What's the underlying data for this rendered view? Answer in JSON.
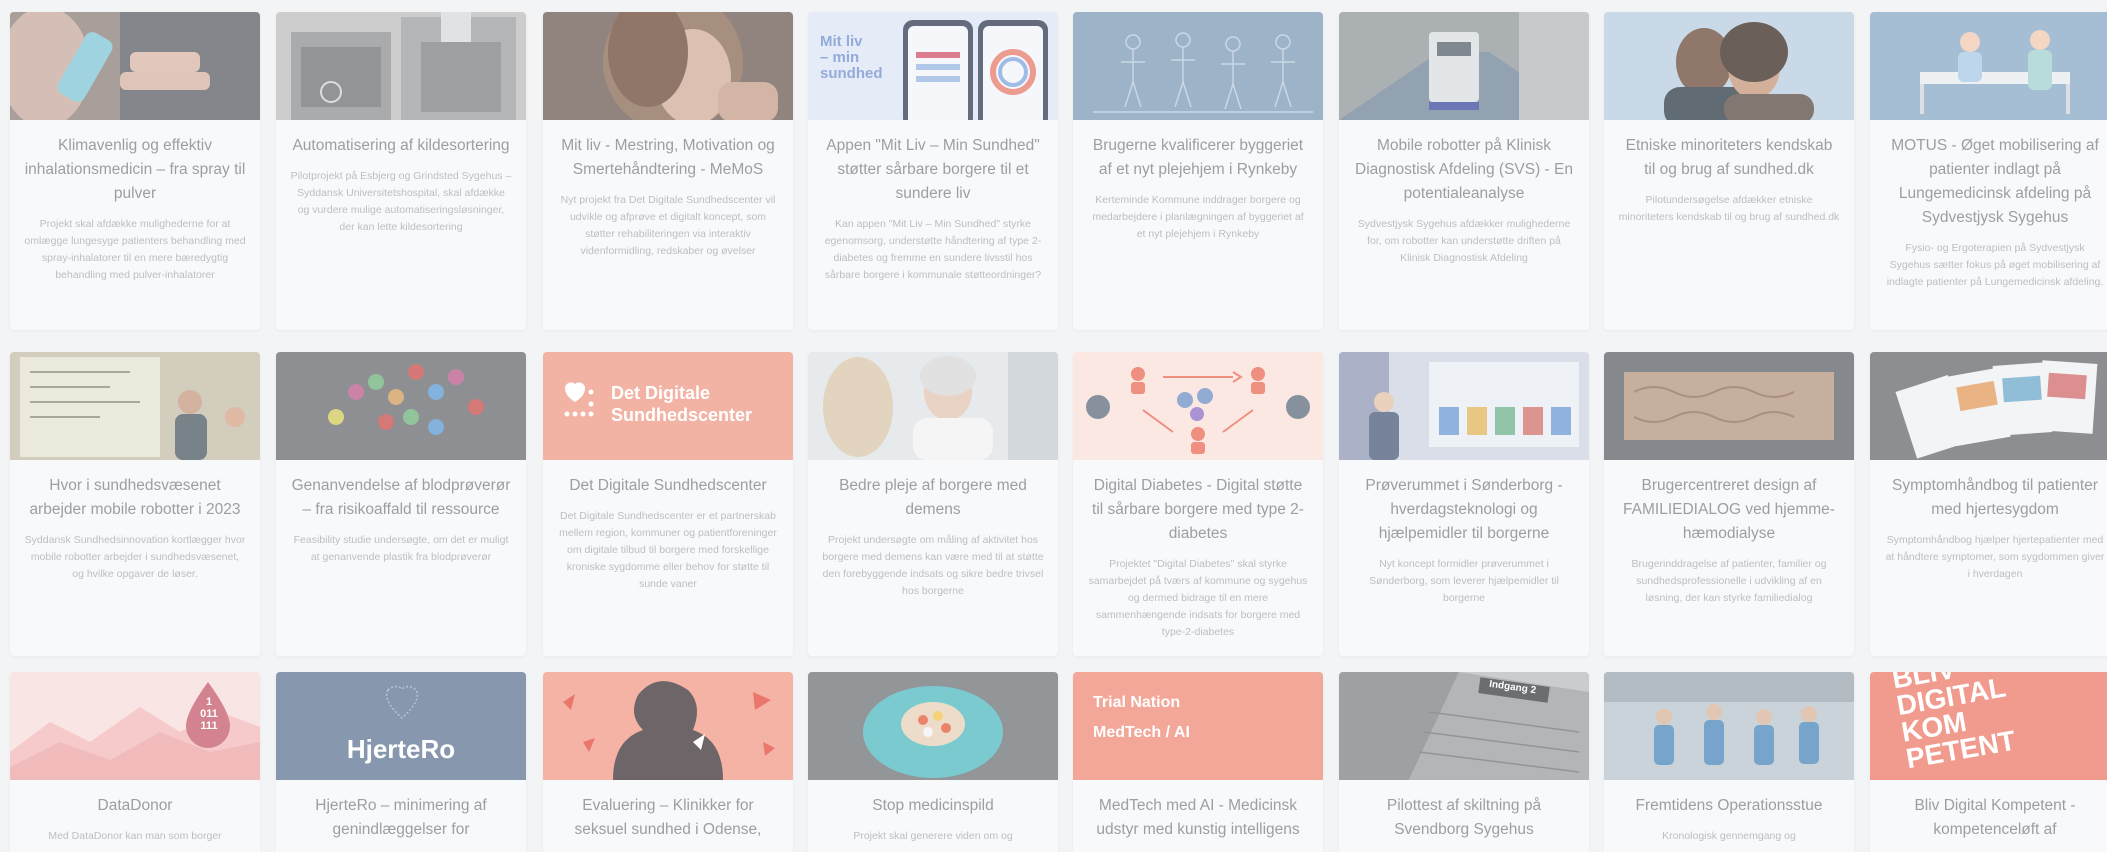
{
  "cards": [
    {
      "title": "Klimavenlig og effektiv inhalationsmedicin – fra spray til pulver",
      "desc": "Projekt skal afdække mulighederne for at omlægge lungesyge patienters behandling med spray-inhalatorer til en mere bæredygtig behandling med pulver-inhalatorer",
      "image": "inhaler-photo"
    },
    {
      "title": "Automatisering af kildesortering",
      "desc": "Pilotprojekt på Esbjerg og Grindsted Sygehus – Syddansk Universitetshospital, skal afdække og vurdere mulige automatiseringsløsninger, der kan lette kildesortering",
      "image": "waste-bins-photo"
    },
    {
      "title": "Mit liv - Mestring, Motivation og Smertehåndtering - MeMoS",
      "desc": "Nyt projekt fra Det Digitale Sundhedscenter vil udvikle og afprøve et digitalt koncept, som støtter rehabiliteringen via interaktiv videnformidling, redskaber og øvelser",
      "image": "woman-pain-photo"
    },
    {
      "title": "Appen \"Mit Liv – Min Sundhed\" støtter sårbare borgere til et sundere liv",
      "desc": "Kan appen \"Mit Liv – Min Sundhed\" styrke egenomsorg, understøtte håndtering af type 2-diabetes og fremme en sundere livsstil hos sårbare borgere i kommunale støtteordninger?",
      "image": "app-screens",
      "overlay": "Mit liv\n– min\nsundhed"
    },
    {
      "title": "Brugerne kvalificerer byggeriet af et nyt plejehjem i Rynkeby",
      "desc": "Kerteminde Kommune inddrager borgere og medarbejdere i planlægningen af byggeriet af et nyt plejehjem i Rynkeby",
      "image": "sketch-people"
    },
    {
      "title": "Mobile robotter på Klinisk Diagnostisk Afdeling (SVS) - En potentialeanalyse",
      "desc": "Sydvestjysk Sygehus afdækker mulighederne for, om robotter kan understøtte driften på Klinisk Diagnostisk Afdeling",
      "image": "robot-corridor-photo"
    },
    {
      "title": "Etniske minoriteters kendskab til og brug af sundhed.dk",
      "desc": "Pilotundersøgelse afdækker etniske minoriteters kendskab til og brug af sundhed.dk",
      "image": "couple-photo"
    },
    {
      "title": "MOTUS - Øget mobilisering af patienter indlagt på Lungemedicinsk afdeling på Sydvestjysk Sygehus",
      "desc": "Fysio- og Ergoterapien på Sydvestjysk Sygehus sætter fokus på øget mobilisering af indlagte patienter på Lungemedicinsk afdeling.",
      "image": "hospital-bed-illustration"
    },
    {
      "title": "Hvor i sundhedsvæsenet arbejder mobile robotter i 2023",
      "desc": "Syddansk Sundhedsinnovation kortlægger hvor mobile robotter arbejder i sundhedsvæsenet, og hvilke opgaver de løser.",
      "image": "whiteboard-photo"
    },
    {
      "title": "Genanvendelse af blodprøverør – fra risikoaffald til ressource",
      "desc": "Feasibility studie undersøgte, om det er muligt at genanvende plastik fra blodprøverør",
      "image": "blood-tubes-photo"
    },
    {
      "title": "Det Digitale Sundhedscenter",
      "desc": "Det Digitale Sundhedscenter er et partnerskab mellem region, kommuner og patientforeninger om digitale tilbud til borgere med forskellige kroniske sygdomme eller behov for støtte til sunde vaner",
      "image": "logo-banner",
      "overlay": "Det Digitale\nSundhedscenter"
    },
    {
      "title": "Bedre pleje af borgere med demens",
      "desc": "Projekt undersøgte om måling af aktivitet hos borgere med demens kan være med til at støtte den forebyggende indsats og sikre bedre trivsel hos borgerne",
      "image": "elderly-woman-photo"
    },
    {
      "title": "Digital Diabetes - Digital støtte til sårbare borgere med type 2-diabetes",
      "desc": "Projektet \"Digital Diabetes\" skal styrke samarbejdet på tværs af kommune og sygehus og dermed bidrage til en mere sammenhængende indsats for borgere med type-2-diabetes",
      "image": "network-illustration"
    },
    {
      "title": "Prøverummet i Sønderborg - hverdagsteknologi og hjælpemidler til borgerne",
      "desc": "Nyt koncept formidler prøverummet i Sønderborg, som leverer hjælpemidler til borgerne",
      "image": "showroom-photo"
    },
    {
      "title": "Brugercentreret design af FAMILIEDIALOG ved hjemme-hæmodialyse",
      "desc": "Brugerinddragelse af patienter, familier og sundhedsprofessionelle i udvikling af en løsning, der kan styrke familiedialog",
      "image": "fabric-photo"
    },
    {
      "title": "Symptomhåndbog til patienter med hjertesygdom",
      "desc": "Symptomhåndbog hjælper hjertepatienter med at håndtere symptomer, som sygdommen giver i hverdagen",
      "image": "booklets-photo"
    },
    {
      "title": "DataDonor",
      "desc": "Med DataDonor kan man som borger",
      "image": "data-drop",
      "overlay": "1\n011\n111"
    },
    {
      "title": "HjerteRo – minimering af genindlæggelser for",
      "desc": "",
      "image": "heart-logo",
      "overlay": "HjerteRo"
    },
    {
      "title": "Evaluering – Klinikker for seksuel sundhed i Odense,",
      "desc": "",
      "image": "silhouette-illustration"
    },
    {
      "title": "Stop medicinspild",
      "desc": "Projekt skal generere viden om og",
      "image": "pills-gloves-photo"
    },
    {
      "title": "MedTech med AI - Medicinsk udstyr med kunstig intelligens",
      "desc": "",
      "image": "trial-nation-banner",
      "overlay": "Trial Nation\nMedTech / AI"
    },
    {
      "title": "Pilottest af skiltning på Svendborg Sygehus",
      "desc": "",
      "image": "building-sign-photo",
      "overlay": "Indgang 2"
    },
    {
      "title": "Fremtidens Operationsstue",
      "desc": "Kronologisk gennemgang og",
      "image": "operating-room-photo"
    },
    {
      "title": "Bliv Digital Kompetent - kompetenceløft af",
      "desc": "",
      "image": "digital-banner",
      "overlay": "BLIV\nDIGITAL\nKOM\nPETENT"
    }
  ],
  "colors": {
    "background": "#eef0f3",
    "card": "#f5f7f9",
    "title": "#7a7e84",
    "desc": "#a6a9ad",
    "salmon": "#ef9a86",
    "slate": "#5f7593"
  }
}
